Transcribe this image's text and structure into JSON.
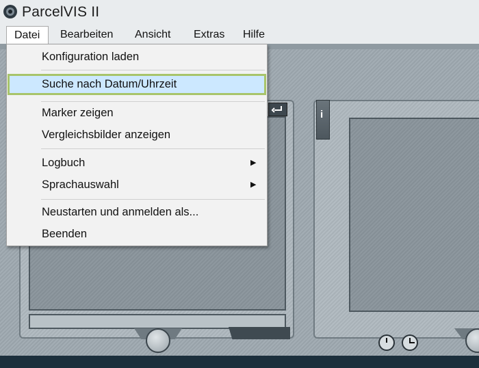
{
  "app": {
    "title": "ParcelVIS II",
    "icon": "camera-lens-icon"
  },
  "menubar": {
    "items": [
      {
        "label": "Datei",
        "active": true
      },
      {
        "label": "Bearbeiten"
      },
      {
        "label": "Ansicht"
      },
      {
        "label": "Extras"
      },
      {
        "label": "Hilfe"
      }
    ]
  },
  "file_menu": {
    "items": [
      {
        "label": "Konfiguration laden"
      },
      {
        "label": "Suche nach Datum/Uhrzeit",
        "highlighted": true
      },
      {
        "label": "Marker zeigen"
      },
      {
        "label": "Vergleichsbilder anzeigen"
      },
      {
        "label": "Logbuch",
        "submenu": true
      },
      {
        "label": "Sprachauswahl",
        "submenu": true
      },
      {
        "label": "Neustarten und anmelden als..."
      },
      {
        "label": "Beenden"
      }
    ],
    "submenu_arrow": "▶"
  },
  "viewer": {
    "info_label": "i"
  },
  "colors": {
    "highlight": "#cce8ff",
    "highlight_border": "#a8c46a",
    "menu_bg": "#f2f2f2"
  }
}
